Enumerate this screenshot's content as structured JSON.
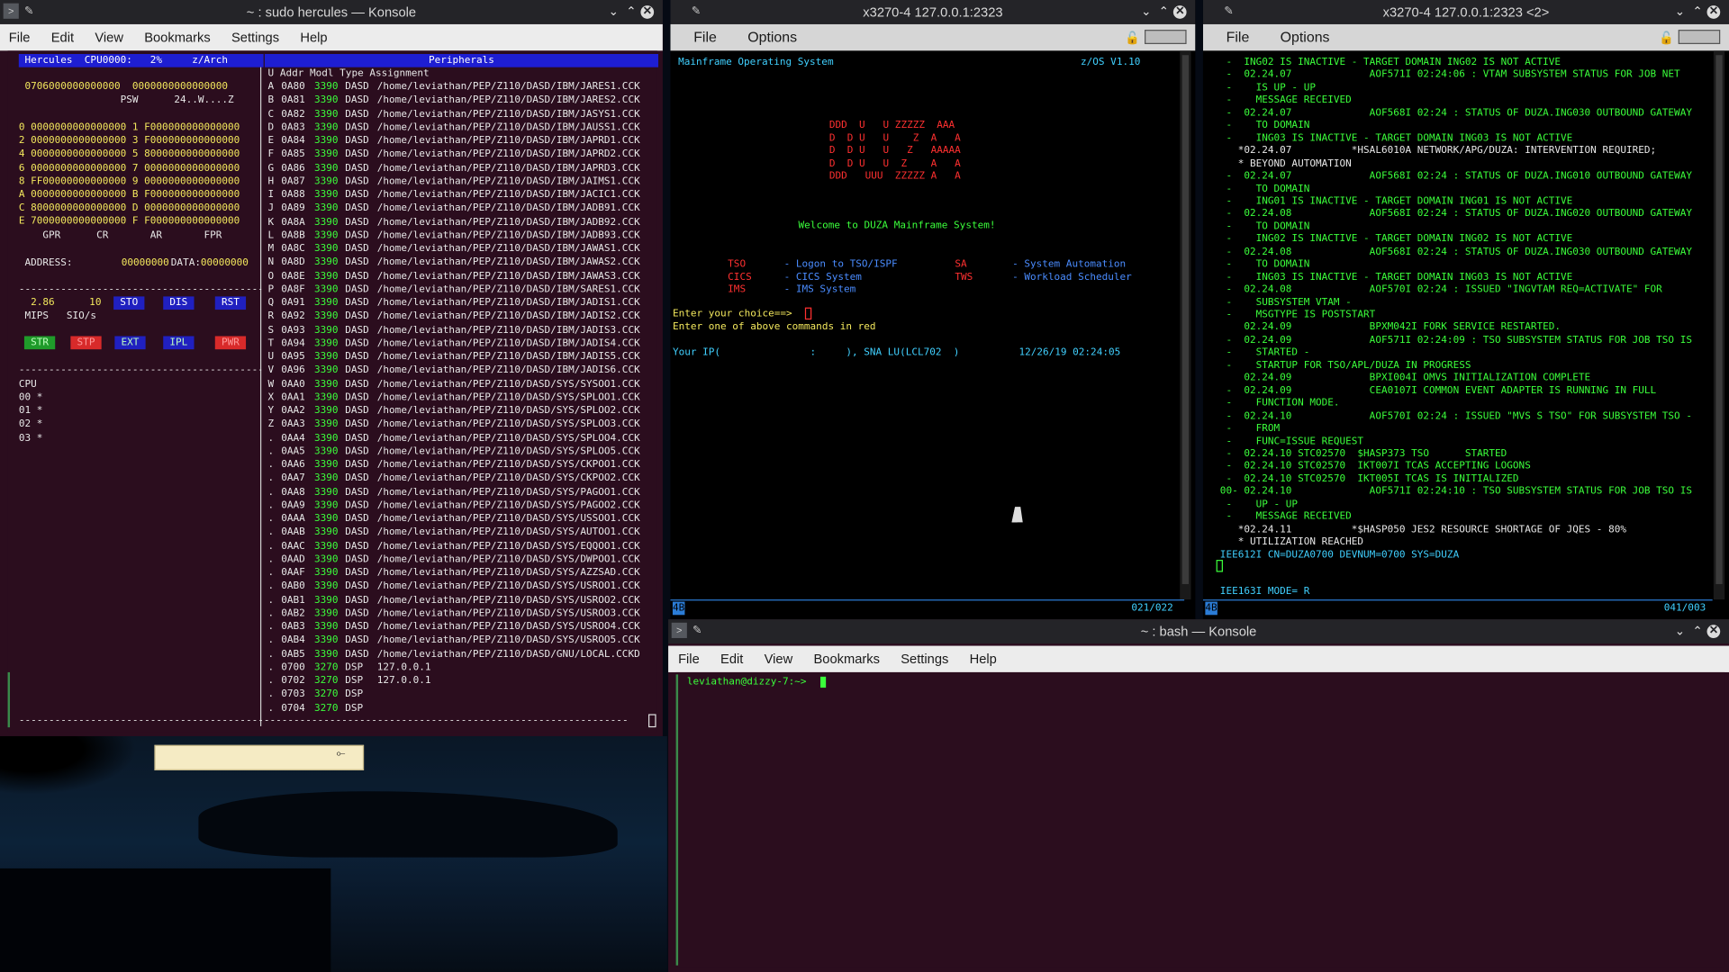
{
  "hercules": {
    "title": "~ : sudo hercules — Konsole",
    "menu": [
      "File",
      "Edit",
      "View",
      "Bookmarks",
      "Settings",
      "Help"
    ],
    "header_left": " Hercules  CPU0000:   2%     z/Arch ",
    "header_right": "Peripherals",
    "psw_line1": " 0706000000000000  0000000000000000",
    "psw_line2": "                 PSW      24..W....Z",
    "gpr_rows": [
      "0 0000000000000000 1 F000000000000000",
      "2 0000000000000000 3 F000000000000000",
      "4 0000000000000000 5 8000000000000000",
      "6 0000000000000000 7 0000000000000000",
      "8 FF00000000000000 9 0000000000000000",
      "A 0000000000000000 B F000000000000000",
      "C 8000000000000000 D 0000000000000000",
      "E 7000000000000000 F F000000000000000"
    ],
    "reg_labels": "    GPR      CR       AR       FPR",
    "address_label": " ADDRESS:",
    "address_value": "00000000",
    "data_label": "DATA:",
    "data_value": "00000000",
    "mips": "  2.86",
    "sios": "10",
    "mips_label": " MIPS   SIO/s",
    "buttons_row1": [
      "STO",
      "DIS",
      "RST"
    ],
    "buttons_row2": [
      "STR",
      "STP",
      "EXT",
      "IPL",
      "PWR"
    ],
    "cpu_label": "CPU",
    "cpu_rows": [
      "00 *",
      "01 *",
      "02 *",
      "03 *"
    ],
    "table_header": "U Addr Modl Type Assignment",
    "devices": [
      [
        "A",
        "0A80",
        "3390",
        "DASD",
        "/home/leviathan/PEP/Z110/DASD/IBM/JARES1.CCK"
      ],
      [
        "B",
        "0A81",
        "3390",
        "DASD",
        "/home/leviathan/PEP/Z110/DASD/IBM/JARES2.CCK"
      ],
      [
        "C",
        "0A82",
        "3390",
        "DASD",
        "/home/leviathan/PEP/Z110/DASD/IBM/JASYS1.CCK"
      ],
      [
        "D",
        "0A83",
        "3390",
        "DASD",
        "/home/leviathan/PEP/Z110/DASD/IBM/JAUSS1.CCK"
      ],
      [
        "E",
        "0A84",
        "3390",
        "DASD",
        "/home/leviathan/PEP/Z110/DASD/IBM/JAPRD1.CCK"
      ],
      [
        "F",
        "0A85",
        "3390",
        "DASD",
        "/home/leviathan/PEP/Z110/DASD/IBM/JAPRD2.CCK"
      ],
      [
        "G",
        "0A86",
        "3390",
        "DASD",
        "/home/leviathan/PEP/Z110/DASD/IBM/JAPRD3.CCK"
      ],
      [
        "H",
        "0A87",
        "3390",
        "DASD",
        "/home/leviathan/PEP/Z110/DASD/IBM/JAIMS1.CCK"
      ],
      [
        "I",
        "0A88",
        "3390",
        "DASD",
        "/home/leviathan/PEP/Z110/DASD/IBM/JACIC1.CCK"
      ],
      [
        "J",
        "0A89",
        "3390",
        "DASD",
        "/home/leviathan/PEP/Z110/DASD/IBM/JADB91.CCK"
      ],
      [
        "K",
        "0A8A",
        "3390",
        "DASD",
        "/home/leviathan/PEP/Z110/DASD/IBM/JADB92.CCK"
      ],
      [
        "L",
        "0A8B",
        "3390",
        "DASD",
        "/home/leviathan/PEP/Z110/DASD/IBM/JADB93.CCK"
      ],
      [
        "M",
        "0A8C",
        "3390",
        "DASD",
        "/home/leviathan/PEP/Z110/DASD/IBM/JAWAS1.CCK"
      ],
      [
        "N",
        "0A8D",
        "3390",
        "DASD",
        "/home/leviathan/PEP/Z110/DASD/IBM/JAWAS2.CCK"
      ],
      [
        "O",
        "0A8E",
        "3390",
        "DASD",
        "/home/leviathan/PEP/Z110/DASD/IBM/JAWAS3.CCK"
      ],
      [
        "P",
        "0A8F",
        "3390",
        "DASD",
        "/home/leviathan/PEP/Z110/DASD/IBM/SARES1.CCK"
      ],
      [
        "Q",
        "0A91",
        "3390",
        "DASD",
        "/home/leviathan/PEP/Z110/DASD/IBM/JADIS1.CCK"
      ],
      [
        "R",
        "0A92",
        "3390",
        "DASD",
        "/home/leviathan/PEP/Z110/DASD/IBM/JADIS2.CCK"
      ],
      [
        "S",
        "0A93",
        "3390",
        "DASD",
        "/home/leviathan/PEP/Z110/DASD/IBM/JADIS3.CCK"
      ],
      [
        "T",
        "0A94",
        "3390",
        "DASD",
        "/home/leviathan/PEP/Z110/DASD/IBM/JADIS4.CCK"
      ],
      [
        "U",
        "0A95",
        "3390",
        "DASD",
        "/home/leviathan/PEP/Z110/DASD/IBM/JADIS5.CCK"
      ],
      [
        "V",
        "0A96",
        "3390",
        "DASD",
        "/home/leviathan/PEP/Z110/DASD/IBM/JADIS6.CCK"
      ],
      [
        "W",
        "0AA0",
        "3390",
        "DASD",
        "/home/leviathan/PEP/Z110/DASD/SYS/SYSOO1.CCK"
      ],
      [
        "X",
        "0AA1",
        "3390",
        "DASD",
        "/home/leviathan/PEP/Z110/DASD/SYS/SPLOO1.CCK"
      ],
      [
        "Y",
        "0AA2",
        "3390",
        "DASD",
        "/home/leviathan/PEP/Z110/DASD/SYS/SPLOO2.CCK"
      ],
      [
        "Z",
        "0AA3",
        "3390",
        "DASD",
        "/home/leviathan/PEP/Z110/DASD/SYS/SPLOO3.CCK"
      ],
      [
        ".",
        "0AA4",
        "3390",
        "DASD",
        "/home/leviathan/PEP/Z110/DASD/SYS/SPLOO4.CCK"
      ],
      [
        ".",
        "0AA5",
        "3390",
        "DASD",
        "/home/leviathan/PEP/Z110/DASD/SYS/SPLOO5.CCK"
      ],
      [
        ".",
        "0AA6",
        "3390",
        "DASD",
        "/home/leviathan/PEP/Z110/DASD/SYS/CKPOO1.CCK"
      ],
      [
        ".",
        "0AA7",
        "3390",
        "DASD",
        "/home/leviathan/PEP/Z110/DASD/SYS/CKPOO2.CCK"
      ],
      [
        ".",
        "0AA8",
        "3390",
        "DASD",
        "/home/leviathan/PEP/Z110/DASD/SYS/PAGOO1.CCK"
      ],
      [
        ".",
        "0AA9",
        "3390",
        "DASD",
        "/home/leviathan/PEP/Z110/DASD/SYS/PAGOO2.CCK"
      ],
      [
        ".",
        "0AAA",
        "3390",
        "DASD",
        "/home/leviathan/PEP/Z110/DASD/SYS/USSOO1.CCK"
      ],
      [
        ".",
        "0AAB",
        "3390",
        "DASD",
        "/home/leviathan/PEP/Z110/DASD/SYS/AUTOO1.CCK"
      ],
      [
        ".",
        "0AAC",
        "3390",
        "DASD",
        "/home/leviathan/PEP/Z110/DASD/SYS/EQQOO1.CCK"
      ],
      [
        ".",
        "0AAD",
        "3390",
        "DASD",
        "/home/leviathan/PEP/Z110/DASD/SYS/DWPOO1.CCK"
      ],
      [
        ".",
        "0AAF",
        "3390",
        "DASD",
        "/home/leviathan/PEP/Z110/DASD/SYS/AZZSAD.CCK"
      ],
      [
        ".",
        "0AB0",
        "3390",
        "DASD",
        "/home/leviathan/PEP/Z110/DASD/SYS/USROO1.CCK"
      ],
      [
        ".",
        "0AB1",
        "3390",
        "DASD",
        "/home/leviathan/PEP/Z110/DASD/SYS/USROO2.CCK"
      ],
      [
        ".",
        "0AB2",
        "3390",
        "DASD",
        "/home/leviathan/PEP/Z110/DASD/SYS/USROO3.CCK"
      ],
      [
        ".",
        "0AB3",
        "3390",
        "DASD",
        "/home/leviathan/PEP/Z110/DASD/SYS/USROO4.CCK"
      ],
      [
        ".",
        "0AB4",
        "3390",
        "DASD",
        "/home/leviathan/PEP/Z110/DASD/SYS/USROO5.CCK"
      ],
      [
        ".",
        "0AB5",
        "3390",
        "DASD",
        "/home/leviathan/PEP/Z110/DASD/GNU/LOCAL.CCKD"
      ],
      [
        ".",
        "0700",
        "3270",
        "DSP ",
        "127.0.0.1"
      ],
      [
        ".",
        "0702",
        "3270",
        "DSP ",
        "127.0.0.1"
      ],
      [
        ".",
        "0703",
        "3270",
        "DSP ",
        ""
      ],
      [
        ".",
        "0704",
        "3270",
        "DSP ",
        ""
      ]
    ]
  },
  "x3270a": {
    "title": "x3270-4 127.0.0.1:2323",
    "menu": [
      "File",
      "Options"
    ],
    "header_left": "Mainframe Operating System",
    "header_right": "z/OS V1.10",
    "logo": [
      "DDD  U   U ZZZZZ  AAA",
      "D  D U   U    Z  A   A",
      "D  D U   U   Z   AAAAA",
      "D  D U   U  Z    A   A",
      "DDD   UUU  ZZZZZ A   A"
    ],
    "welcome": "Welcome to DUZA Mainframe System!",
    "menu_items": [
      {
        "cmd": "TSO",
        "desc": "- Logon to TSO/ISPF",
        "cmd2": "SA",
        "desc2": "- System Automation"
      },
      {
        "cmd": "CICS",
        "desc": "- CICS System",
        "cmd2": "TWS",
        "desc2": "- Workload Scheduler"
      },
      {
        "cmd": "IMS",
        "desc": "- IMS System",
        "cmd2": "",
        "desc2": ""
      }
    ],
    "prompt": "Enter your choice==>",
    "hint": "Enter one of above commands in red",
    "ip_line": "Your IP(               :     ), SNA LU(LCL702  )",
    "timestamp": "12/26/19 02:24:05",
    "status_left": "4B",
    "status_right": "021/022"
  },
  "x3270b": {
    "title": "x3270-4 127.0.0.1:2323 <2>",
    "menu": [
      "File",
      "Options"
    ],
    "lines": [
      {
        "t": "  -  ING02 IS INACTIVE - TARGET DOMAIN ING02 IS NOT ACTIVE",
        "c": "g"
      },
      {
        "t": "  -  02.24.07             AOF571I 02:24:06 : VTAM SUBSYSTEM STATUS FOR JOB NET",
        "c": "g"
      },
      {
        "t": "  -    IS UP - UP",
        "c": "g"
      },
      {
        "t": "  -    MESSAGE RECEIVED",
        "c": "g"
      },
      {
        "t": "  -  02.24.07             AOF568I 02:24 : STATUS OF DUZA.ING030 OUTBOUND GATEWAY",
        "c": "g"
      },
      {
        "t": "  -    TO DOMAIN",
        "c": "g"
      },
      {
        "t": "  -    ING03 IS INACTIVE - TARGET DOMAIN ING03 IS NOT ACTIVE",
        "c": "g"
      },
      {
        "t": "    *02.24.07          *HSAL6010A NETWORK/APG/DUZA: INTERVENTION REQUIRED;",
        "c": "w"
      },
      {
        "t": "    * BEYOND AUTOMATION",
        "c": "w"
      },
      {
        "t": "  -  02.24.07             AOF568I 02:24 : STATUS OF DUZA.ING010 OUTBOUND GATEWAY",
        "c": "g"
      },
      {
        "t": "  -    TO DOMAIN",
        "c": "g"
      },
      {
        "t": "  -    ING01 IS INACTIVE - TARGET DOMAIN ING01 IS NOT ACTIVE",
        "c": "g"
      },
      {
        "t": "  -  02.24.08             AOF568I 02:24 : STATUS OF DUZA.ING020 OUTBOUND GATEWAY",
        "c": "g"
      },
      {
        "t": "  -    TO DOMAIN",
        "c": "g"
      },
      {
        "t": "  -    ING02 IS INACTIVE - TARGET DOMAIN ING02 IS NOT ACTIVE",
        "c": "g"
      },
      {
        "t": "  -  02.24.08             AOF568I 02:24 : STATUS OF DUZA.ING030 OUTBOUND GATEWAY",
        "c": "g"
      },
      {
        "t": "  -    TO DOMAIN",
        "c": "g"
      },
      {
        "t": "  -    ING03 IS INACTIVE - TARGET DOMAIN ING03 IS NOT ACTIVE",
        "c": "g"
      },
      {
        "t": "  -  02.24.08             AOF570I 02:24 : ISSUED \"INGVTAM REQ=ACTIVATE\" FOR",
        "c": "g"
      },
      {
        "t": "  -    SUBSYSTEM VTAM -",
        "c": "g"
      },
      {
        "t": "  -    MSGTYPE IS POSTSTART",
        "c": "g"
      },
      {
        "t": "     02.24.09             BPXM042I FORK SERVICE RESTARTED.",
        "c": "g"
      },
      {
        "t": "  -  02.24.09             AOF571I 02:24:09 : TSO SUBSYSTEM STATUS FOR JOB TSO IS",
        "c": "g"
      },
      {
        "t": "  -    STARTED -",
        "c": "g"
      },
      {
        "t": "  -    STARTUP FOR TSO/APL/DUZA IN PROGRESS",
        "c": "g"
      },
      {
        "t": "     02.24.09             BPXI004I OMVS INITIALIZATION COMPLETE",
        "c": "g"
      },
      {
        "t": "  -  02.24.09             CEA0107I COMMON EVENT ADAPTER IS RUNNING IN FULL",
        "c": "g"
      },
      {
        "t": "  -    FUNCTION MODE.",
        "c": "g"
      },
      {
        "t": "  -  02.24.10             AOF570I 02:24 : ISSUED \"MVS S TSO\" FOR SUBSYSTEM TSO -",
        "c": "g"
      },
      {
        "t": "  -    FROM",
        "c": "g"
      },
      {
        "t": "  -    FUNC=ISSUE REQUEST",
        "c": "g"
      },
      {
        "t": "  -  02.24.10 STC02570  $HASP373 TSO      STARTED",
        "c": "g"
      },
      {
        "t": "  -  02.24.10 STC02570  IKT007I TCAS ACCEPTING LOGONS",
        "c": "g"
      },
      {
        "t": "  -  02.24.10 STC02570  IKT005I TCAS IS INITIALIZED",
        "c": "g"
      },
      {
        "t": " 00- 02.24.10             AOF571I 02:24:10 : TSO SUBSYSTEM STATUS FOR JOB TSO IS",
        "c": "g"
      },
      {
        "t": "  -    UP - UP",
        "c": "g"
      },
      {
        "t": "  -    MESSAGE RECEIVED",
        "c": "g"
      },
      {
        "t": "    *02.24.11          *$HASP050 JES2 RESOURCE SHORTAGE OF JQES - 80%",
        "c": "w"
      },
      {
        "t": "    * UTILIZATION REACHED",
        "c": "w"
      },
      {
        "t": " IEE612I CN=DUZA0700 DEVNUM=0700 SYS=DUZA",
        "c": "c"
      }
    ],
    "mode_line": " IEE163I MODE= R",
    "status_left": "4B",
    "status_right": "041/003"
  },
  "bash": {
    "title": "~ : bash — Konsole",
    "menu": [
      "File",
      "Edit",
      "View",
      "Bookmarks",
      "Settings",
      "Help"
    ],
    "prompt": "leviathan@dizzy-7:~>"
  },
  "colors": {
    "terminal_bg": "#2b0d1e",
    "x3270_bg": "#000000",
    "accent": "#2b7cd6",
    "hercules_header": "#2020c0"
  }
}
